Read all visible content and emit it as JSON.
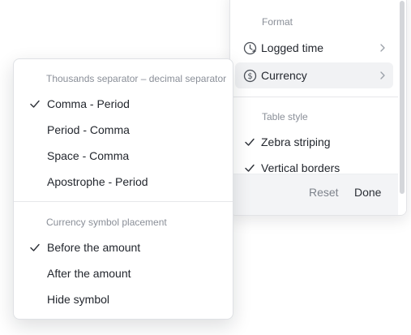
{
  "main_menu": {
    "format": {
      "heading": "Format",
      "items": [
        {
          "label": "Logged time",
          "icon": "clock-icon",
          "active": false
        },
        {
          "label": "Currency",
          "icon": "dollar-circle-icon",
          "active": true
        }
      ]
    },
    "table_style": {
      "heading": "Table style",
      "items": [
        {
          "label": "Zebra striping",
          "checked": true
        },
        {
          "label": "Vertical borders",
          "checked": true
        }
      ]
    },
    "footer": {
      "reset_label": "Reset",
      "done_label": "Done"
    }
  },
  "currency_submenu": {
    "separators": {
      "heading": "Thousands separator – decimal separator",
      "items": [
        {
          "label": "Comma - Period",
          "checked": true
        },
        {
          "label": "Period - Comma",
          "checked": false
        },
        {
          "label": "Space - Comma",
          "checked": false
        },
        {
          "label": "Apostrophe - Period",
          "checked": false
        }
      ]
    },
    "symbol_placement": {
      "heading": "Currency symbol placement",
      "items": [
        {
          "label": "Before the amount",
          "checked": true
        },
        {
          "label": "After the amount",
          "checked": false
        },
        {
          "label": "Hide symbol",
          "checked": false
        }
      ]
    }
  },
  "colors": {
    "text": "#23272e",
    "muted": "#8a8f98",
    "active_row": "#f1f2f4",
    "footer_bg": "#f3f4f6"
  }
}
